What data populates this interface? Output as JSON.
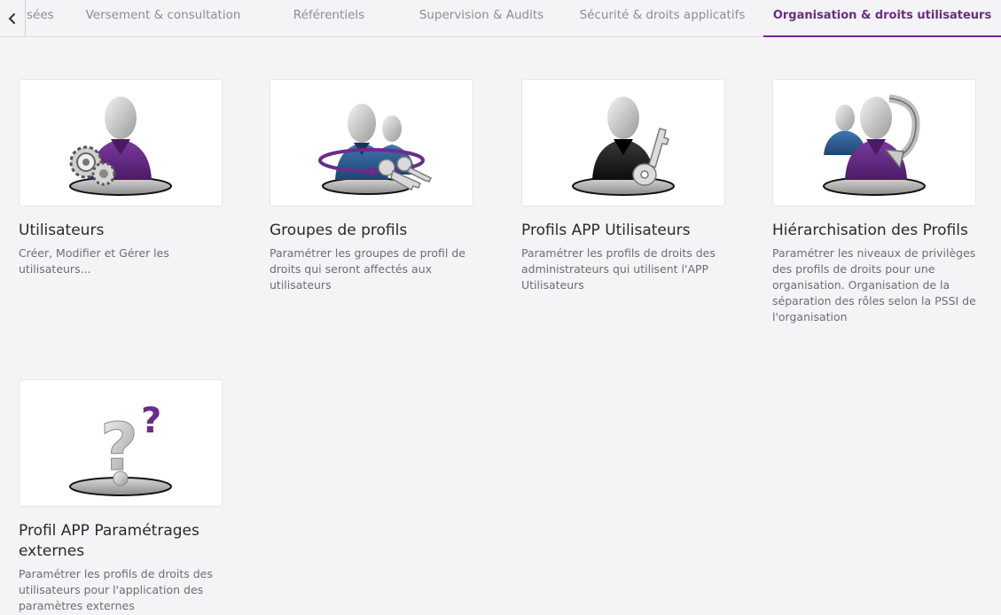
{
  "tabs": [
    {
      "label": "sées",
      "active": false
    },
    {
      "label": "Versement & consultation",
      "active": false
    },
    {
      "label": "Référentiels",
      "active": false
    },
    {
      "label": "Supervision & Audits",
      "active": false
    },
    {
      "label": "Sécurité & droits applicatifs",
      "active": false
    },
    {
      "label": "Organisation & droits utilisateurs",
      "active": true
    }
  ],
  "colors": {
    "accent": "#6e2a86",
    "purple_shirt": "#6b2c8c",
    "blue_shirt": "#2f5f96",
    "background": "#f4f4f7"
  },
  "cards": [
    {
      "icon": "user-gears-icon",
      "title": "Utilisateurs",
      "description": "Créer, Modifier et Gérer les utilisateurs..."
    },
    {
      "icon": "user-group-keys-icon",
      "title": "Groupes de profils",
      "description": "Paramétrer les groupes de profil de droits qui seront affectés aux utilisateurs"
    },
    {
      "icon": "user-key-icon",
      "title": "Profils APP Utilisateurs",
      "description": "Paramétrer les profils de droits des administrateurs qui utilisent l'APP Utilisateurs"
    },
    {
      "icon": "user-hierarchy-icon",
      "title": "Hiérarchisation des Profils",
      "description": "Paramétrer les niveaux de privilèges des profils de droits pour une organisation. Organisation de la séparation des rôles selon la PSSI de l'organisation"
    },
    {
      "icon": "question-mark-icon",
      "title": "Profil APP Paramétrages externes",
      "description": "Paramétrer les profils de droits des utilisateurs pour l'application des paramètres externes"
    }
  ]
}
